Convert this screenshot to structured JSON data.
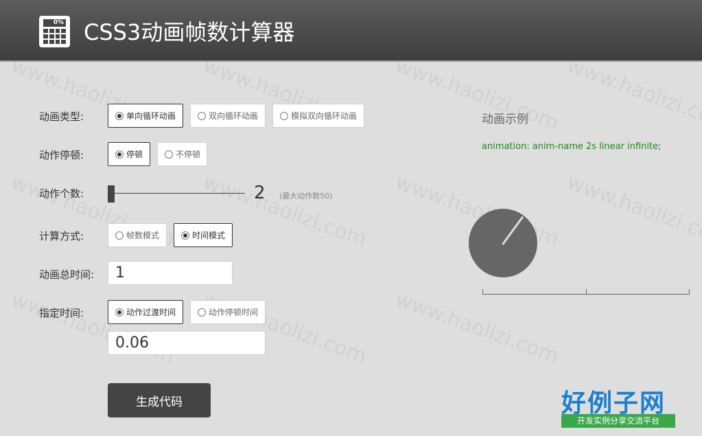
{
  "header": {
    "icon_screen_text": "0%",
    "title": "CSS3动画帧数计算器"
  },
  "form": {
    "anim_type": {
      "label": "动画类型:",
      "options": [
        "单向循环动画",
        "双向循环动画",
        "模拟双向循环动画"
      ],
      "selected": 0
    },
    "pause": {
      "label": "动作停顿:",
      "options": [
        "停顿",
        "不停顿"
      ],
      "selected": 0
    },
    "action_count": {
      "label": "动作个数:",
      "value": "2",
      "note": "(最大动作数50)"
    },
    "calc_mode": {
      "label": "计算方式:",
      "options": [
        "帧数模式",
        "时间模式"
      ],
      "selected": 1
    },
    "total_time": {
      "label": "动画总时间:",
      "value": "1"
    },
    "specified_time": {
      "label": "指定时间:",
      "options": [
        "动作过渡时间",
        "动作停顿时间"
      ],
      "selected": 0,
      "value": "0.06"
    },
    "generate_button": "生成代码"
  },
  "preview": {
    "title": "动画示例",
    "code": "animation: anim-name 2s linear infinite;"
  },
  "watermark": {
    "text": "www.haolizi.com",
    "brand_main": "好例子网",
    "brand_sub": "开发实例分享交流平台"
  }
}
